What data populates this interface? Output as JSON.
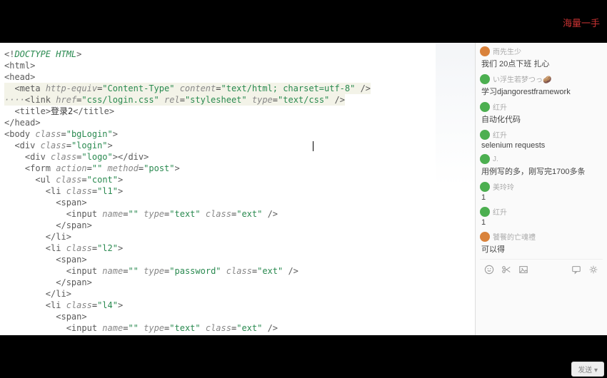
{
  "topbar": {
    "text_fragment": "海量一手"
  },
  "code": {
    "lines": [
      {
        "indent": 0,
        "raw": "<!DOCTYPE HTML>",
        "doctype": true
      },
      {
        "indent": 0,
        "raw": "<html>"
      },
      {
        "indent": 0,
        "raw": "<head>"
      },
      {
        "indent": 2,
        "tag": "meta",
        "attrs": [
          [
            "http-equiv",
            "Content-Type"
          ],
          [
            "content",
            "text/html; charset=utf-8"
          ]
        ],
        "self": true,
        "hl": true
      },
      {
        "indent": 2,
        "tag": "link",
        "attrs": [
          [
            "href",
            "css/login.css"
          ],
          [
            "rel",
            "stylesheet"
          ],
          [
            "type",
            "text/css"
          ]
        ],
        "self": true,
        "hl": true,
        "lead": "····"
      },
      {
        "indent": 2,
        "open": "title",
        "text": "登录2",
        "close": "title"
      },
      {
        "indent": 0,
        "raw": "</head>"
      },
      {
        "indent": 0,
        "open": "body",
        "attrs": [
          [
            "class",
            "bgLogin"
          ]
        ]
      },
      {
        "indent": 2,
        "open": "div",
        "attrs": [
          [
            "class",
            "login"
          ]
        ],
        "cursor": true
      },
      {
        "indent": 4,
        "open": "div",
        "attrs": [
          [
            "class",
            "logo"
          ]
        ],
        "close_inline": "div"
      },
      {
        "indent": 4,
        "open": "form",
        "attrs": [
          [
            "action",
            ""
          ],
          [
            "method",
            "post"
          ]
        ]
      },
      {
        "indent": 6,
        "open": "ul",
        "attrs": [
          [
            "class",
            "cont"
          ]
        ]
      },
      {
        "indent": 8,
        "open": "li",
        "attrs": [
          [
            "class",
            "l1"
          ]
        ]
      },
      {
        "indent": 10,
        "open": "span"
      },
      {
        "indent": 12,
        "tag": "input",
        "attrs": [
          [
            "name",
            ""
          ],
          [
            "type",
            "text"
          ],
          [
            "class",
            "ext"
          ]
        ],
        "self": true
      },
      {
        "indent": 10,
        "close": "span"
      },
      {
        "indent": 8,
        "close": "li"
      },
      {
        "indent": 8,
        "open": "li",
        "attrs": [
          [
            "class",
            "l2"
          ]
        ]
      },
      {
        "indent": 10,
        "open": "span"
      },
      {
        "indent": 12,
        "tag": "input",
        "attrs": [
          [
            "name",
            ""
          ],
          [
            "type",
            "password"
          ],
          [
            "class",
            "ext"
          ]
        ],
        "self": true
      },
      {
        "indent": 10,
        "close": "span"
      },
      {
        "indent": 8,
        "close": "li"
      },
      {
        "indent": 8,
        "open": "li",
        "attrs": [
          [
            "class",
            "l4"
          ]
        ]
      },
      {
        "indent": 10,
        "open": "span"
      },
      {
        "indent": 12,
        "tag": "input",
        "attrs": [
          [
            "name",
            ""
          ],
          [
            "type",
            "text"
          ],
          [
            "class",
            "ext"
          ]
        ],
        "self": true
      }
    ]
  },
  "chat": {
    "messages": [
      {
        "avatar": "orange",
        "user": "雨先生少",
        "text": "我们 20点下班 扎心"
      },
      {
        "avatar": "green",
        "user": "い浮生若梦つっ🥔",
        "text": "学习djangorestframework"
      },
      {
        "avatar": "green",
        "user": "红升",
        "text": "自动化代码"
      },
      {
        "avatar": "green",
        "user": "红升",
        "text": "selenium  requests"
      },
      {
        "avatar": "green",
        "user": "J.",
        "text": "用例写的多，刚写完1700多条"
      },
      {
        "avatar": "green",
        "user": "美玲玲",
        "text": "1"
      },
      {
        "avatar": "green",
        "user": "红升",
        "text": "1"
      },
      {
        "avatar": "orange",
        "user": "饕餮的亡魂禮",
        "text": "可以得"
      }
    ],
    "send_label": "发送"
  }
}
